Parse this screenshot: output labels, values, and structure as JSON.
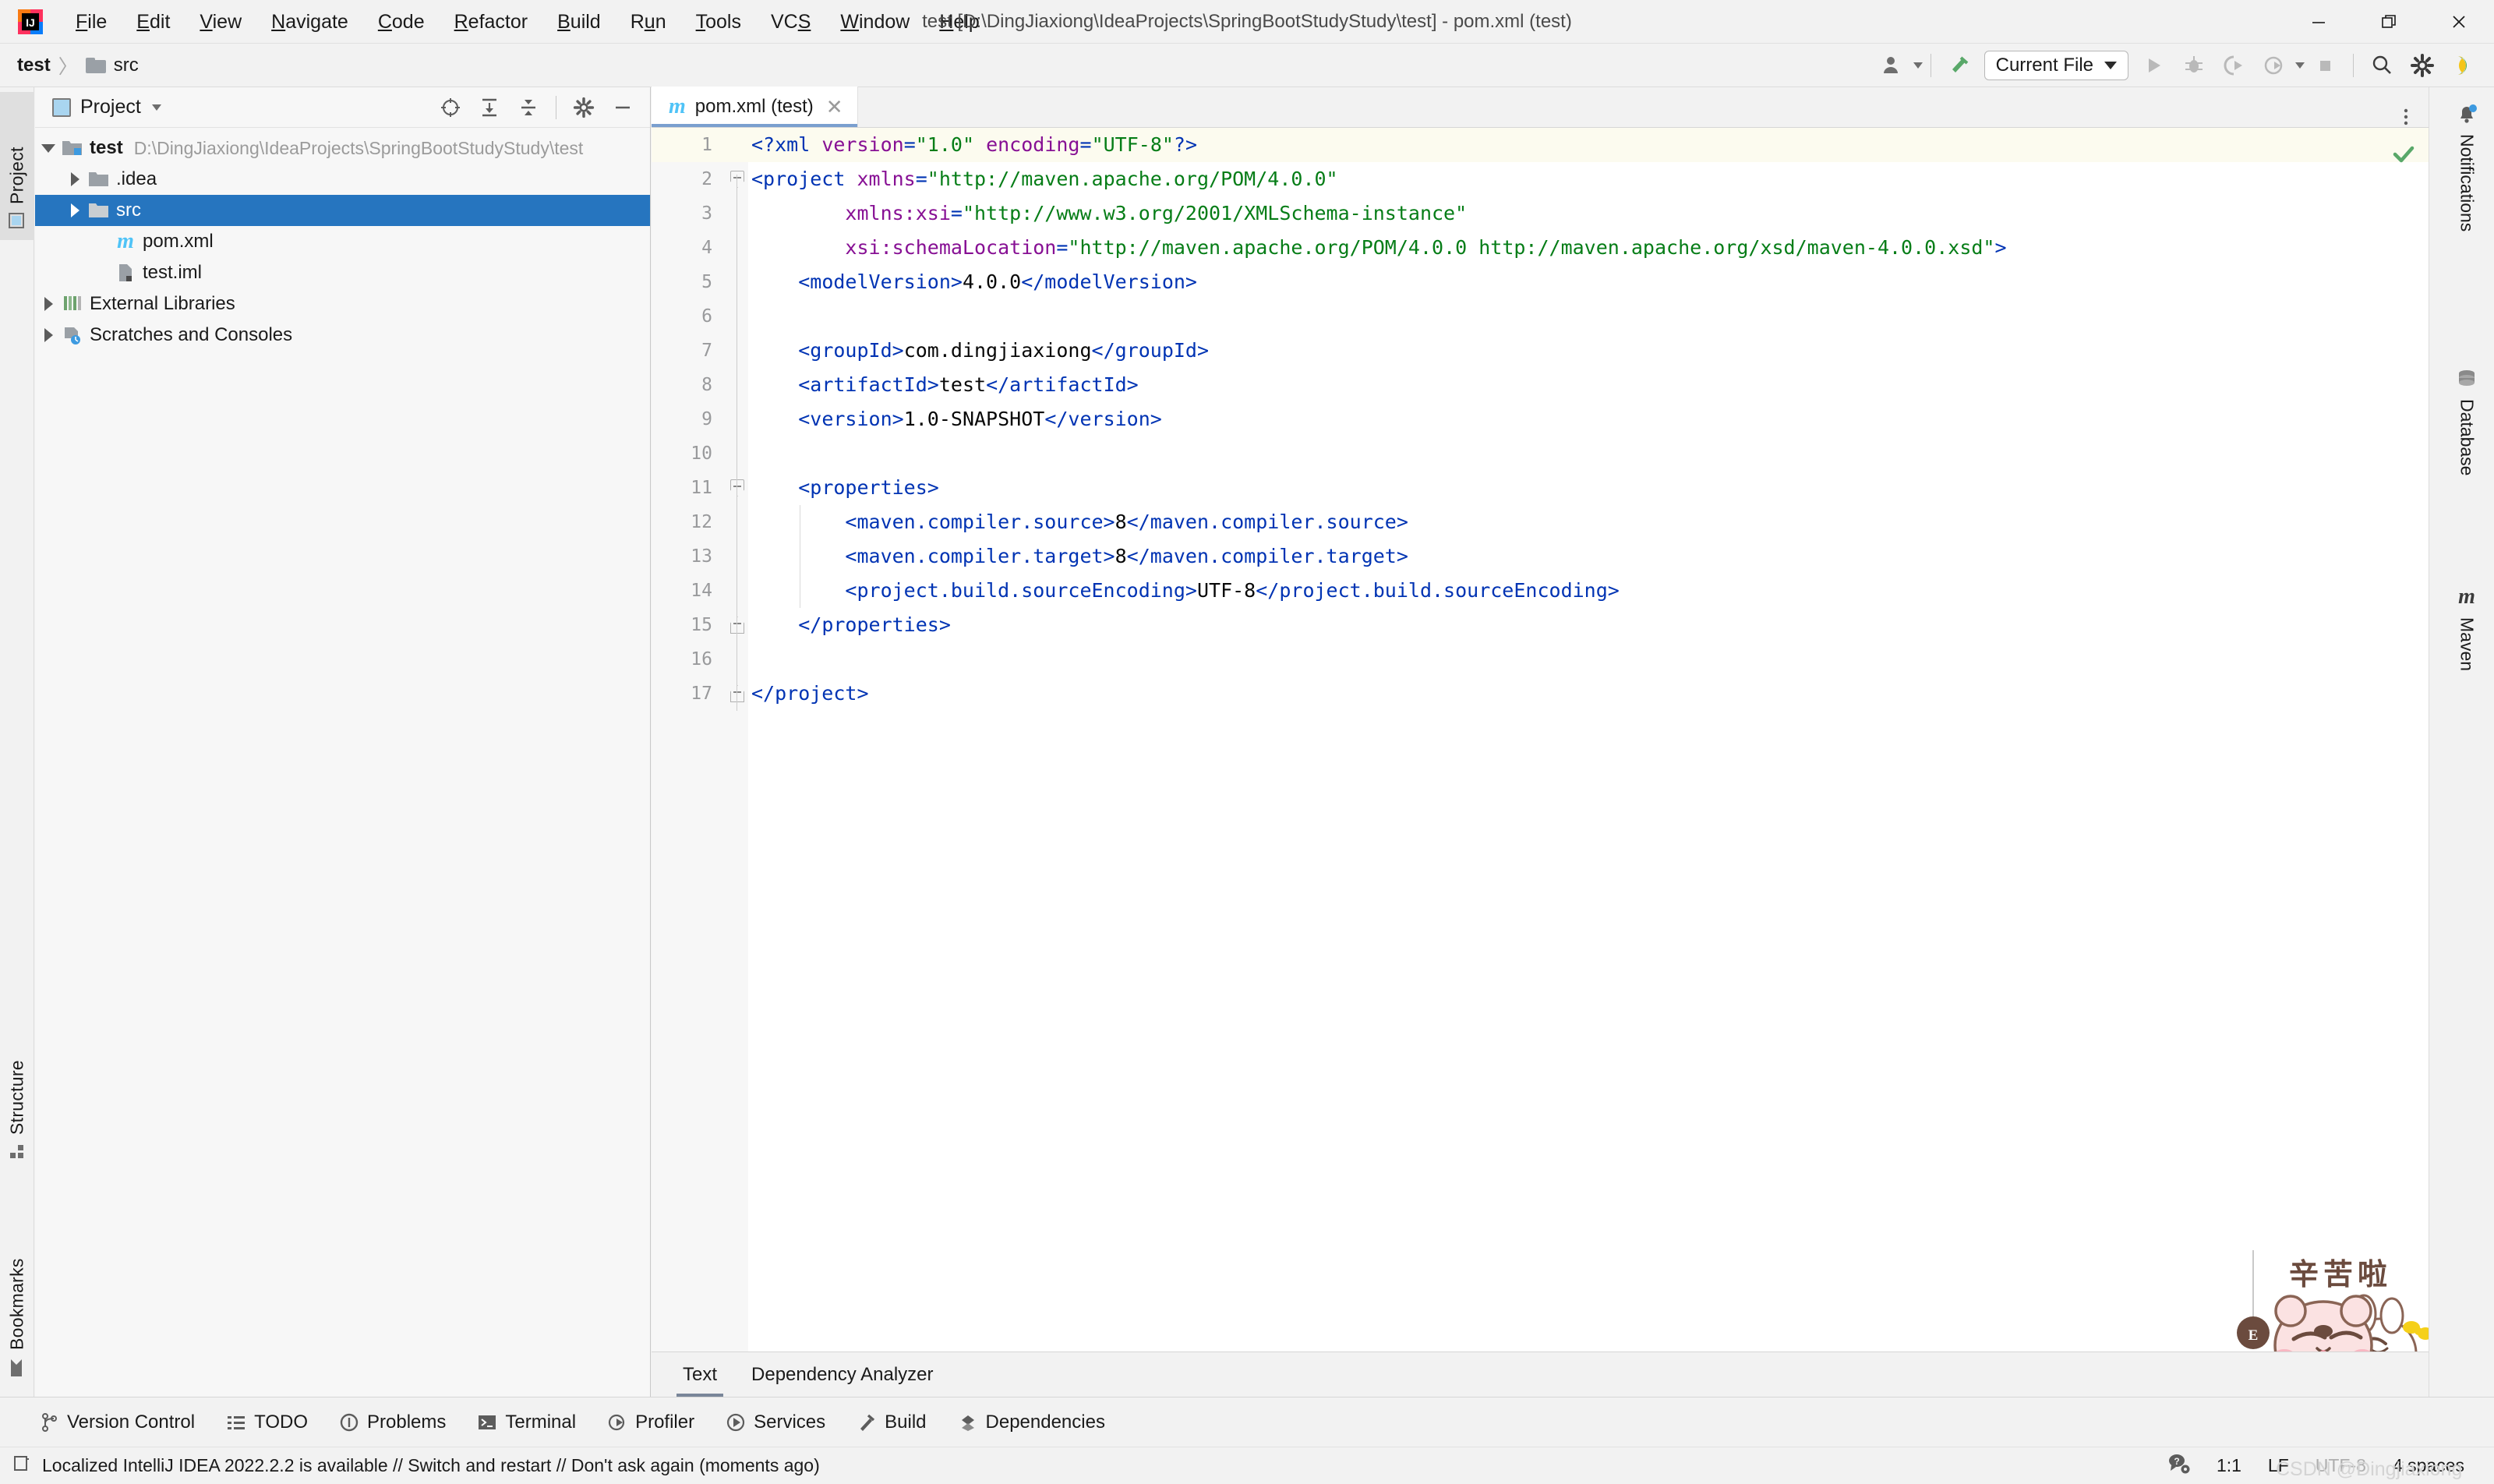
{
  "window": {
    "title": "test [D:\\DingJiaxiong\\IdeaProjects\\SpringBootStudyStudy\\test] - pom.xml (test)",
    "logo_name": "intellij-idea-logo",
    "controls": {
      "minimize": "—",
      "restore": "❐",
      "close": "✕"
    }
  },
  "menu": {
    "items": [
      {
        "label": "File",
        "mnemonic": "F"
      },
      {
        "label": "Edit",
        "mnemonic": "E"
      },
      {
        "label": "View",
        "mnemonic": "V"
      },
      {
        "label": "Navigate",
        "mnemonic": "N"
      },
      {
        "label": "Code",
        "mnemonic": "C"
      },
      {
        "label": "Refactor",
        "mnemonic": "R"
      },
      {
        "label": "Build",
        "mnemonic": "B"
      },
      {
        "label": "Run",
        "mnemonic": "u"
      },
      {
        "label": "Tools",
        "mnemonic": "T"
      },
      {
        "label": "VCS",
        "mnemonic": "S"
      },
      {
        "label": "Window",
        "mnemonic": "W"
      },
      {
        "label": "Help",
        "mnemonic": "H"
      }
    ]
  },
  "breadcrumb": {
    "project": "test",
    "separator": "〉",
    "node": "src"
  },
  "toolbar": {
    "run_config": "Current File",
    "icons": [
      "user-avatar-icon",
      "build-hammer-icon",
      "run-icon",
      "debug-icon",
      "run-with-coverage-icon",
      "profile-icon",
      "stop-icon",
      "search-everywhere-icon",
      "settings-gear-icon",
      "ide-feature-icon"
    ]
  },
  "left_stripe": {
    "tabs": [
      {
        "label": "Project",
        "icon": "project-icon",
        "active": true
      },
      {
        "label": "Structure",
        "icon": "structure-icon",
        "active": false
      },
      {
        "label": "Bookmarks",
        "icon": "bookmark-icon",
        "active": false
      }
    ]
  },
  "right_stripe": {
    "tabs": [
      {
        "label": "Notifications",
        "icon": "bell-icon"
      },
      {
        "label": "Database",
        "icon": "database-icon"
      },
      {
        "label": "Maven",
        "icon": "maven-m-icon"
      }
    ]
  },
  "project_panel": {
    "title": "Project",
    "toolbar_icons": [
      "select-opened-file-icon",
      "expand-all-icon",
      "collapse-all-icon",
      "panel-settings-icon",
      "hide-panel-icon"
    ],
    "tree": [
      {
        "label": "test",
        "path": "D:\\DingJiaxiong\\IdeaProjects\\SpringBootStudyStudy\\test",
        "indent": 0,
        "arrow": "down",
        "icon": "project-module-icon",
        "bold": true,
        "selected": false
      },
      {
        "label": ".idea",
        "path": "",
        "indent": 1,
        "arrow": "right",
        "icon": "folder-icon",
        "bold": false,
        "selected": false
      },
      {
        "label": "src",
        "path": "",
        "indent": 1,
        "arrow": "right",
        "icon": "folder-icon",
        "bold": false,
        "selected": true
      },
      {
        "label": "pom.xml",
        "path": "",
        "indent": 2,
        "arrow": "none",
        "icon": "maven-m-icon",
        "bold": false,
        "selected": false
      },
      {
        "label": "test.iml",
        "path": "",
        "indent": 2,
        "arrow": "none",
        "icon": "iml-file-icon",
        "bold": false,
        "selected": false
      },
      {
        "label": "External Libraries",
        "path": "",
        "indent": 0,
        "arrow": "right",
        "icon": "libraries-icon",
        "bold": false,
        "selected": false
      },
      {
        "label": "Scratches and Consoles",
        "path": "",
        "indent": 0,
        "arrow": "right",
        "icon": "scratches-icon",
        "bold": false,
        "selected": false
      }
    ]
  },
  "editor": {
    "tab": {
      "label": "pom.xml (test)",
      "icon": "maven-m-icon",
      "close": "✕"
    },
    "inspection_status": "ok-check-icon",
    "bottom_tabs": [
      {
        "label": "Text",
        "active": true
      },
      {
        "label": "Dependency Analyzer",
        "active": false
      }
    ],
    "code_lines": [
      {
        "n": 1,
        "current": true,
        "fold": "none",
        "segs": [
          {
            "t": "tag",
            "v": "<?xml"
          },
          {
            "t": "txt",
            "v": " "
          },
          {
            "t": "attr",
            "v": "version"
          },
          {
            "t": "tag",
            "v": "="
          },
          {
            "t": "val",
            "v": "\"1.0\""
          },
          {
            "t": "txt",
            "v": " "
          },
          {
            "t": "attr",
            "v": "encoding"
          },
          {
            "t": "tag",
            "v": "="
          },
          {
            "t": "val",
            "v": "\"UTF-8\""
          },
          {
            "t": "tag",
            "v": "?>"
          }
        ]
      },
      {
        "n": 2,
        "current": false,
        "fold": "open",
        "segs": [
          {
            "t": "tag",
            "v": "<project "
          },
          {
            "t": "attr",
            "v": "xmlns"
          },
          {
            "t": "tag",
            "v": "="
          },
          {
            "t": "val",
            "v": "\"http://maven.apache.org/POM/4.0.0\""
          }
        ]
      },
      {
        "n": 3,
        "current": false,
        "fold": "none",
        "segs": [
          {
            "t": "txt",
            "v": "        "
          },
          {
            "t": "attr",
            "v": "xmlns:xsi"
          },
          {
            "t": "tag",
            "v": "="
          },
          {
            "t": "val",
            "v": "\"http://www.w3.org/2001/XMLSchema-instance\""
          }
        ]
      },
      {
        "n": 4,
        "current": false,
        "fold": "none",
        "segs": [
          {
            "t": "txt",
            "v": "        "
          },
          {
            "t": "attr",
            "v": "xsi:schemaLocation"
          },
          {
            "t": "tag",
            "v": "="
          },
          {
            "t": "val",
            "v": "\"http://maven.apache.org/POM/4.0.0 http://maven.apache.org/xsd/maven-4.0.0.xsd\""
          },
          {
            "t": "tag",
            "v": ">"
          }
        ]
      },
      {
        "n": 5,
        "current": false,
        "fold": "none",
        "segs": [
          {
            "t": "txt",
            "v": "    "
          },
          {
            "t": "tag",
            "v": "<modelVersion>"
          },
          {
            "t": "txt",
            "v": "4.0.0"
          },
          {
            "t": "tag",
            "v": "</modelVersion>"
          }
        ]
      },
      {
        "n": 6,
        "current": false,
        "fold": "none",
        "segs": []
      },
      {
        "n": 7,
        "current": false,
        "fold": "none",
        "segs": [
          {
            "t": "txt",
            "v": "    "
          },
          {
            "t": "tag",
            "v": "<groupId>"
          },
          {
            "t": "txt",
            "v": "com.dingjiaxiong"
          },
          {
            "t": "tag",
            "v": "</groupId>"
          }
        ]
      },
      {
        "n": 8,
        "current": false,
        "fold": "none",
        "segs": [
          {
            "t": "txt",
            "v": "    "
          },
          {
            "t": "tag",
            "v": "<artifactId>"
          },
          {
            "t": "txt",
            "v": "test"
          },
          {
            "t": "tag",
            "v": "</artifactId>"
          }
        ]
      },
      {
        "n": 9,
        "current": false,
        "fold": "none",
        "segs": [
          {
            "t": "txt",
            "v": "    "
          },
          {
            "t": "tag",
            "v": "<version>"
          },
          {
            "t": "txt",
            "v": "1.0-SNAPSHOT"
          },
          {
            "t": "tag",
            "v": "</version>"
          }
        ]
      },
      {
        "n": 10,
        "current": false,
        "fold": "none",
        "segs": []
      },
      {
        "n": 11,
        "current": false,
        "fold": "open",
        "segs": [
          {
            "t": "txt",
            "v": "    "
          },
          {
            "t": "tag",
            "v": "<properties>"
          }
        ]
      },
      {
        "n": 12,
        "current": false,
        "fold": "none",
        "indent_guide": true,
        "segs": [
          {
            "t": "txt",
            "v": "        "
          },
          {
            "t": "tag",
            "v": "<maven.compiler.source>"
          },
          {
            "t": "txt",
            "v": "8"
          },
          {
            "t": "tag",
            "v": "</maven.compiler.source>"
          }
        ]
      },
      {
        "n": 13,
        "current": false,
        "fold": "none",
        "indent_guide": true,
        "segs": [
          {
            "t": "txt",
            "v": "        "
          },
          {
            "t": "tag",
            "v": "<maven.compiler.target>"
          },
          {
            "t": "txt",
            "v": "8"
          },
          {
            "t": "tag",
            "v": "</maven.compiler.target>"
          }
        ]
      },
      {
        "n": 14,
        "current": false,
        "fold": "none",
        "indent_guide": true,
        "segs": [
          {
            "t": "txt",
            "v": "        "
          },
          {
            "t": "tag",
            "v": "<project.build.sourceEncoding>"
          },
          {
            "t": "txt",
            "v": "UTF-8"
          },
          {
            "t": "tag",
            "v": "</project.build.sourceEncoding>"
          }
        ]
      },
      {
        "n": 15,
        "current": false,
        "fold": "close",
        "segs": [
          {
            "t": "txt",
            "v": "    "
          },
          {
            "t": "tag",
            "v": "</properties>"
          }
        ]
      },
      {
        "n": 16,
        "current": false,
        "fold": "none",
        "segs": []
      },
      {
        "n": 17,
        "current": false,
        "fold": "close",
        "segs": [
          {
            "t": "tag",
            "v": "</project>"
          }
        ]
      }
    ]
  },
  "bottom_bar": {
    "items": [
      {
        "label": "Version Control",
        "icon": "branch-icon"
      },
      {
        "label": "TODO",
        "icon": "todo-list-icon"
      },
      {
        "label": "Problems",
        "icon": "problems-icon"
      },
      {
        "label": "Terminal",
        "icon": "terminal-icon"
      },
      {
        "label": "Profiler",
        "icon": "profiler-icon"
      },
      {
        "label": "Services",
        "icon": "services-icon"
      },
      {
        "label": "Build",
        "icon": "build-hammer-icon"
      },
      {
        "label": "Dependencies",
        "icon": "dependencies-icon"
      }
    ]
  },
  "status_bar": {
    "icon": "event-log-icon",
    "message": "Localized IntelliJ IDEA 2022.2.2 is available // Switch and restart // Don't ask again (moments ago)",
    "right": {
      "help_icon": "help-settings-icon",
      "caret": "1:1",
      "line_separator": "LF",
      "encoding": "UTF-8",
      "indent": "4 spaces"
    }
  },
  "sticker": {
    "text": "辛苦啦",
    "name": "cute-bears-sticker"
  },
  "watermark": {
    "text": "CSDN @Dingjiaxiong"
  },
  "colors": {
    "accent_selection": "#2675bf",
    "xml_tag": "#0033b3",
    "xml_attr": "#871094",
    "xml_value": "#067d17",
    "current_line": "#fcfbef",
    "chrome_bg": "#f2f2f2"
  }
}
